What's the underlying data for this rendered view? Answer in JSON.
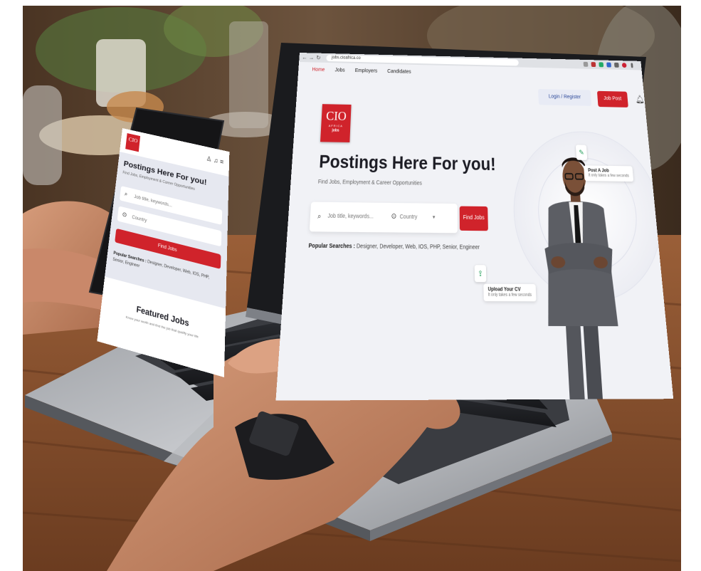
{
  "laptop": {
    "browser": {
      "back_icon": "arrow-left-icon",
      "forward_icon": "arrow-right-icon",
      "reload_icon": "reload-icon",
      "url": "jobs.cioafrica.co"
    },
    "nav": [
      {
        "label": "Home",
        "active": true
      },
      {
        "label": "Jobs",
        "active": false
      },
      {
        "label": "Employers",
        "active": false
      },
      {
        "label": "Candidates",
        "active": false
      }
    ],
    "logo": {
      "mark": "CIO",
      "region": "AFRICA",
      "sub": "jobs"
    },
    "login_label": "Login / Register",
    "job_post_label": "Job Post",
    "bell_icon": "bell-icon",
    "hero": {
      "title": "Postings Here For you!",
      "subtitle": "Find Jobs, Employment & Career Opportunities"
    },
    "search": {
      "keyword_placeholder": "Job title, keywords...",
      "country_placeholder": "Country",
      "button_label": "Find Jobs"
    },
    "popular": {
      "label": "Popular Searches :",
      "terms": "Designer, Developer, Web, IOS, PHP, Senior, Engineer"
    },
    "post_job_card": {
      "title": "Post A Job",
      "desc": "It only takes a few seconds"
    },
    "upload_cv_card": {
      "title": "Upload Your CV",
      "desc": "It only takes a few seconds"
    }
  },
  "phone": {
    "logo": {
      "mark": "CIO"
    },
    "header_icons": "user-icon bell-icon menu-icon",
    "title": "Postings Here For you!",
    "subtitle": "Find Jobs, Employment & Career Opportunities",
    "keyword_placeholder": "Job title, keywords...",
    "country_placeholder": "Country",
    "button_label": "Find Jobs",
    "popular_label": "Popular Searches :",
    "popular_terms": "Designer, Developer, Web, IOS, PHP, Senior, Engineer",
    "featured_title": "Featured Jobs",
    "featured_sub": "Know your worth and find the job that qualify your life"
  },
  "colors": {
    "brand_red": "#d0232b",
    "login_bg": "#e8ebf5",
    "login_text": "#2e4a9a"
  }
}
